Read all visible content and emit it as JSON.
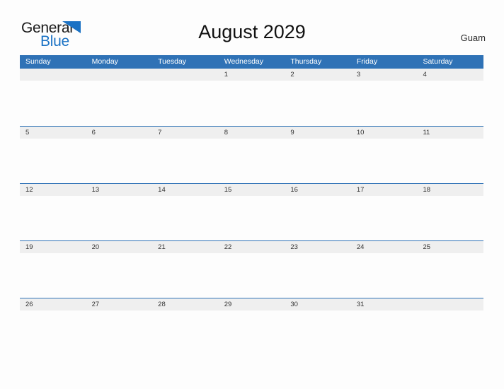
{
  "brand": {
    "word_one": "General",
    "word_two": "Blue",
    "flag_icon": "blue-flag-triangle",
    "accent_color": "#1b72c4"
  },
  "header": {
    "title": "August 2029",
    "location": "Guam"
  },
  "calendar": {
    "header_color": "#2f72b6",
    "band_color": "#efefef",
    "rule_color": "#2f72b6",
    "weekdays": [
      "Sunday",
      "Monday",
      "Tuesday",
      "Wednesday",
      "Thursday",
      "Friday",
      "Saturday"
    ],
    "weeks": [
      [
        "",
        "",
        "",
        "1",
        "2",
        "3",
        "4"
      ],
      [
        "5",
        "6",
        "7",
        "8",
        "9",
        "10",
        "11"
      ],
      [
        "12",
        "13",
        "14",
        "15",
        "16",
        "17",
        "18"
      ],
      [
        "19",
        "20",
        "21",
        "22",
        "23",
        "24",
        "25"
      ],
      [
        "26",
        "27",
        "28",
        "29",
        "30",
        "31",
        ""
      ]
    ]
  }
}
